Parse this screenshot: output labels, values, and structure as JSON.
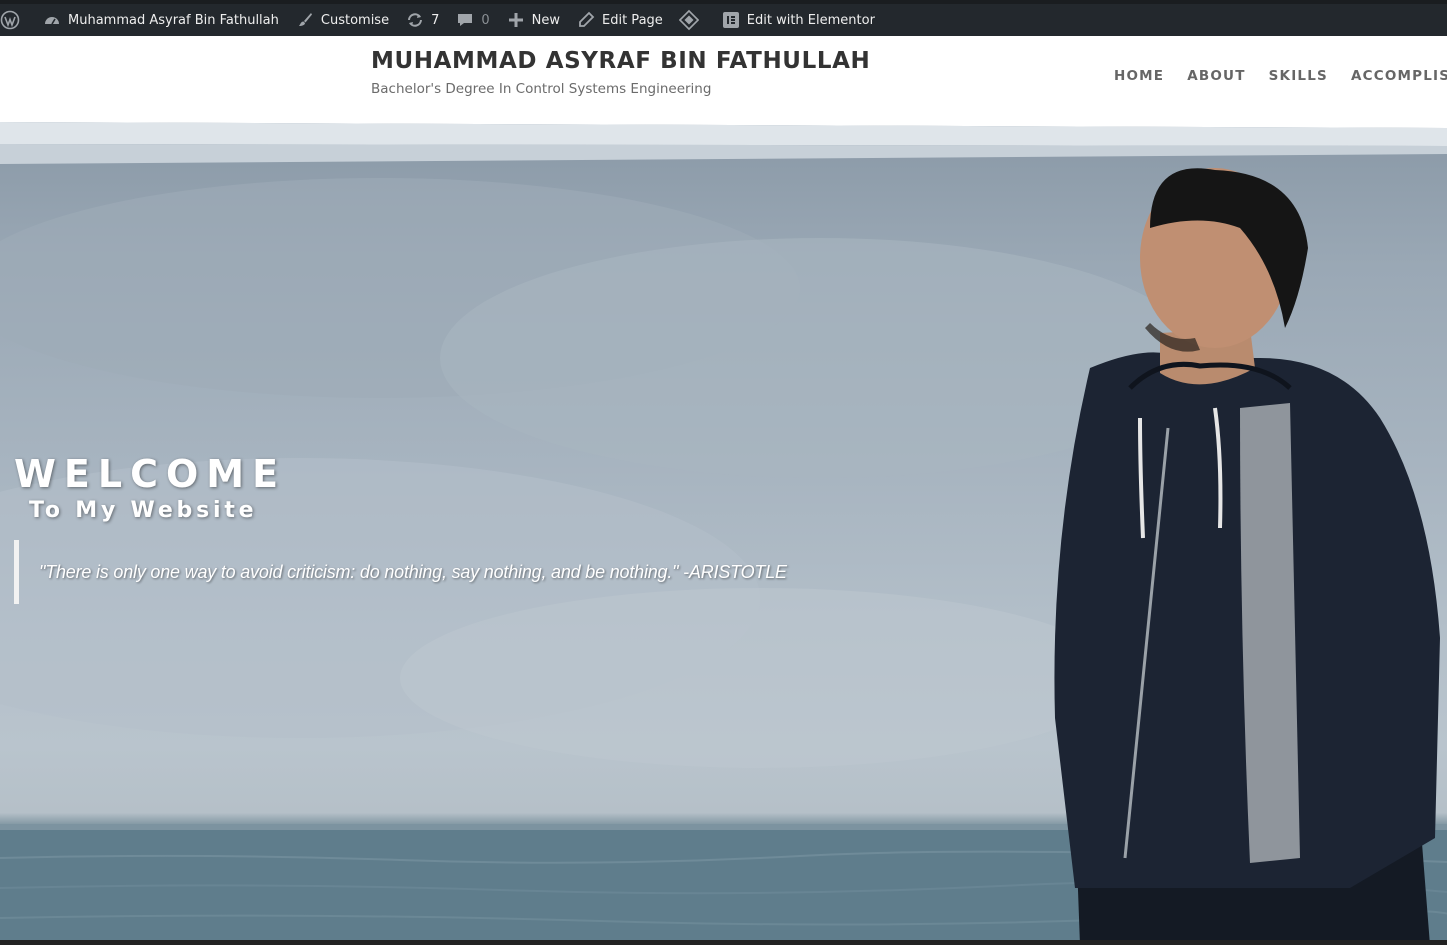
{
  "adminbar": {
    "site_name": "Muhammad Asyraf Bin Fathullah",
    "customise": "Customise",
    "updates_count": "7",
    "comments_count": "0",
    "new": "New",
    "edit_page": "Edit Page",
    "edit_elementor": "Edit with Elementor"
  },
  "header": {
    "site_title": "MUHAMMAD ASYRAF BIN FATHULLAH",
    "tagline": "Bachelor's Degree In Control Systems Engineering",
    "nav": [
      "HOME",
      "ABOUT",
      "SKILLS",
      "ACCOMPLISHM"
    ]
  },
  "hero": {
    "title": "WELCOME",
    "subtitle": "To My Website",
    "quote": "\"There is only one way to avoid criticism: do nothing, say nothing, and be nothing.\" -ARISTOTLE"
  },
  "colors": {
    "adminbar_bg": "#23282d",
    "header_bg": "#ffffff",
    "title": "#333333",
    "nav": "#666666",
    "hero_text": "#ffffff"
  },
  "icons": [
    "wordpress-logo-icon",
    "dashboard-icon",
    "paintbrush-icon",
    "updates-icon",
    "comment-icon",
    "plus-icon",
    "pencil-icon",
    "diamond-icon",
    "elementor-icon"
  ]
}
